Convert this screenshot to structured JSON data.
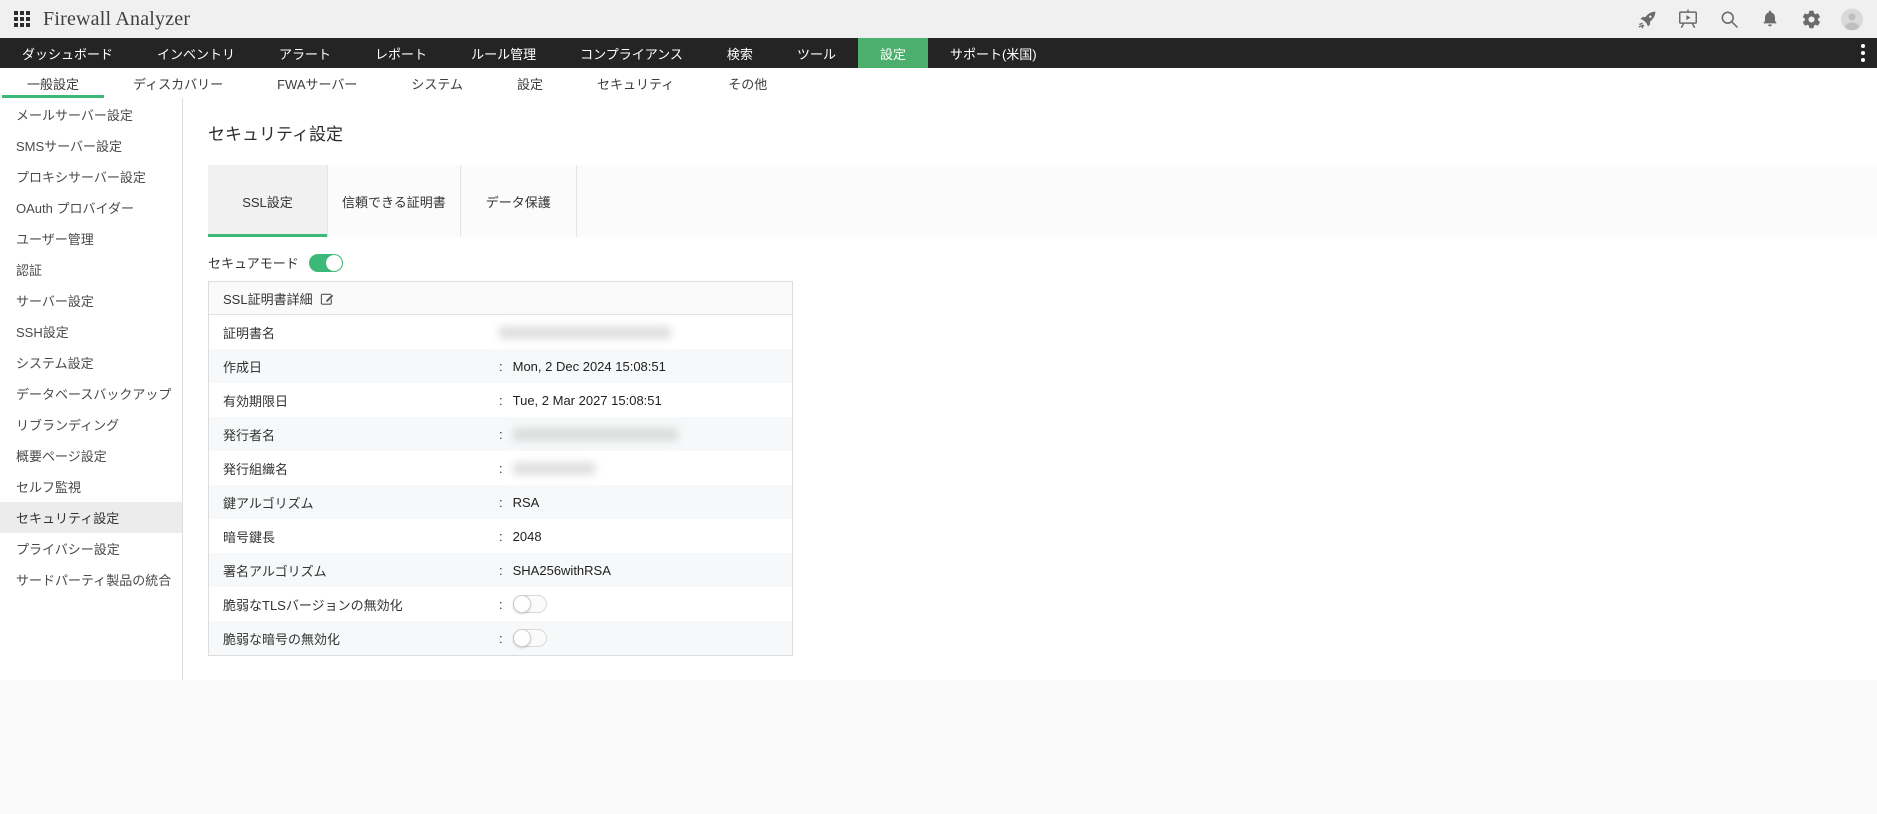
{
  "header": {
    "title": "Firewall Analyzer",
    "action_icons": [
      "apps-grid-icon",
      "rocket-icon",
      "demo-video-icon",
      "search-icon",
      "notifications-icon",
      "settings-gear-icon",
      "user-avatar"
    ]
  },
  "main_nav": {
    "items": [
      {
        "label": "ダッシュボード",
        "active": false
      },
      {
        "label": "インベントリ",
        "active": false
      },
      {
        "label": "アラート",
        "active": false
      },
      {
        "label": "レポート",
        "active": false
      },
      {
        "label": "ルール管理",
        "active": false
      },
      {
        "label": "コンプライアンス",
        "active": false
      },
      {
        "label": "検索",
        "active": false
      },
      {
        "label": "ツール",
        "active": false
      },
      {
        "label": "設定",
        "active": true
      },
      {
        "label": "サポート(米国)",
        "active": false
      }
    ],
    "overflow_icon": "vertical-dots-menu"
  },
  "sub_nav": {
    "items": [
      {
        "label": "一般設定",
        "active": true
      },
      {
        "label": "ディスカバリー",
        "active": false
      },
      {
        "label": "FWAサーバー",
        "active": false
      },
      {
        "label": "システム",
        "active": false
      },
      {
        "label": "設定",
        "active": false
      },
      {
        "label": "セキュリティ",
        "active": false
      },
      {
        "label": "その他",
        "active": false
      }
    ]
  },
  "sidebar": {
    "items": [
      {
        "label": "メールサーバー設定",
        "active": false
      },
      {
        "label": "SMSサーバー設定",
        "active": false
      },
      {
        "label": "プロキシサーバー設定",
        "active": false
      },
      {
        "label": "OAuth プロバイダー",
        "active": false
      },
      {
        "label": "ユーザー管理",
        "active": false
      },
      {
        "label": "認証",
        "active": false
      },
      {
        "label": "サーバー設定",
        "active": false
      },
      {
        "label": "SSH設定",
        "active": false
      },
      {
        "label": "システム設定",
        "active": false
      },
      {
        "label": "データベースバックアップ",
        "active": false
      },
      {
        "label": "リブランディング",
        "active": false
      },
      {
        "label": "概要ページ設定",
        "active": false
      },
      {
        "label": "セルフ監視",
        "active": false
      },
      {
        "label": "セキュリティ設定",
        "active": true
      },
      {
        "label": "プライバシー設定",
        "active": false
      },
      {
        "label": "サードパーティ製品の統合",
        "active": false
      }
    ]
  },
  "main": {
    "page_title": "セキュリティ設定",
    "tabs": [
      {
        "label": "SSL設定",
        "active": true
      },
      {
        "label": "信頼できる証明書",
        "active": false
      },
      {
        "label": "データ保護",
        "active": false
      }
    ],
    "secure_mode": {
      "label": "セキュアモード",
      "on": true
    },
    "cert_table": {
      "title": "SSL証明書詳細",
      "rows": [
        {
          "label": "証明書名",
          "value": "",
          "redacted": true
        },
        {
          "label": "作成日",
          "value": "Mon, 2 Dec 2024 15:08:51"
        },
        {
          "label": "有効期限日",
          "value": "Tue, 2 Mar 2027 15:08:51"
        },
        {
          "label": "発行者名",
          "value": "",
          "redacted": true
        },
        {
          "label": "発行組織名",
          "value": "",
          "redacted": true
        },
        {
          "label": "鍵アルゴリズム",
          "value": "RSA"
        },
        {
          "label": "暗号鍵長",
          "value": "2048"
        },
        {
          "label": "署名アルゴリズム",
          "value": "SHA256withRSA"
        },
        {
          "label": "脆弱なTLSバージョンの無効化",
          "toggle_on": false
        },
        {
          "label": "脆弱な暗号の無効化",
          "toggle_on": false
        }
      ]
    }
  },
  "colors": {
    "accent_green": "#3cb878",
    "nav_active_green": "#4caf6e",
    "nav_bg": "#242424",
    "header_bg": "#f0f0f0"
  }
}
